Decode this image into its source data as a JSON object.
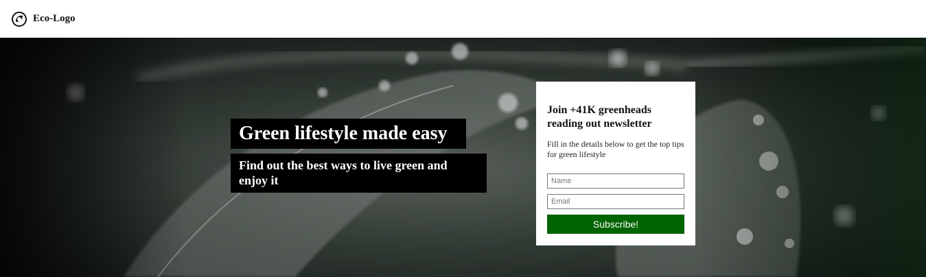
{
  "header": {
    "logo_icon": "eco-leaf-circle-icon",
    "logo_text": "Eco-Logo"
  },
  "hero": {
    "background": "dark-green-leaf-with-water-drops-photo",
    "headline": "Green lifestyle made easy",
    "subheadline": "Find out the best ways to live green and enjoy it"
  },
  "newsletter": {
    "title": "Join +41K greenheads reading out newsletter",
    "description": "Fill in the details below to get the top tips for green lifestyle",
    "name_placeholder": "Name",
    "email_placeholder": "Email",
    "name_value": "",
    "email_value": "",
    "subscribe_label": "Subscribe!"
  },
  "colors": {
    "accent": "#006400",
    "text_box_bg": "#000000",
    "header_bg": "#ffffff"
  }
}
